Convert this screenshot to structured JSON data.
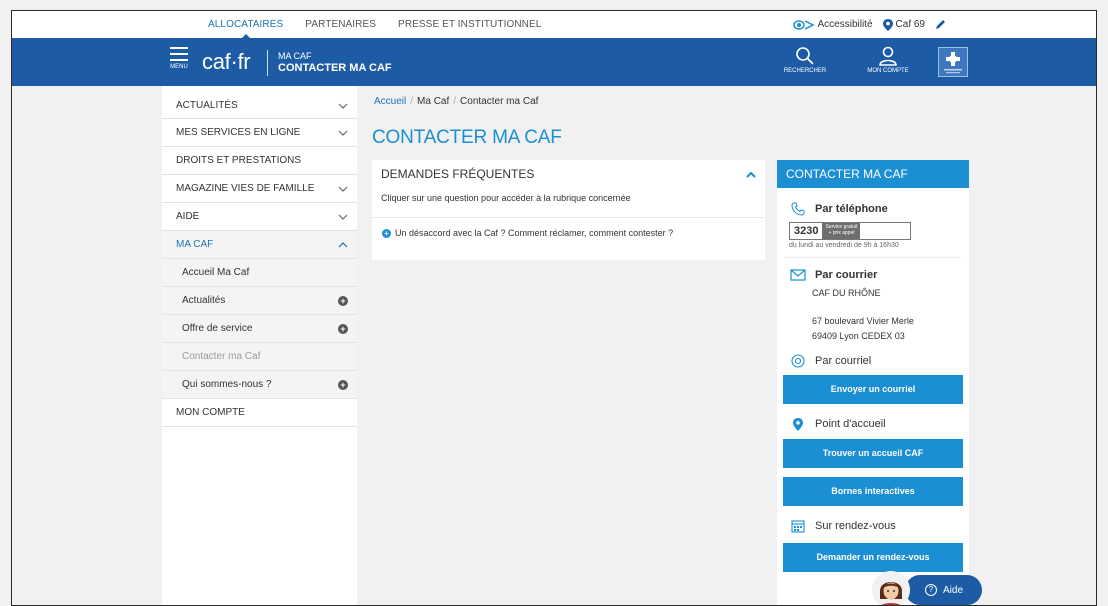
{
  "topbar": {
    "nav": [
      "ALLOCATAIRES",
      "PARTENAIRES",
      "PRESSE ET INSTITUTIONNEL"
    ],
    "accessibility": "Accessibilité",
    "location": "Caf 69"
  },
  "header": {
    "menu_label": "MENU",
    "logo": "caf·fr",
    "section_small": "MA CAF",
    "section_big": "CONTACTER MA CAF",
    "search_label": "RECHERCHER",
    "account_label": "MON COMPTE"
  },
  "sidebar": {
    "items": [
      {
        "label": "ACTUALITÉS"
      },
      {
        "label": "MES SERVICES EN LIGNE"
      },
      {
        "label": "DROITS ET PRESTATIONS"
      },
      {
        "label": "MAGAZINE VIES DE FAMILLE"
      },
      {
        "label": "AIDE"
      },
      {
        "label": "MA CAF"
      }
    ],
    "sub_items": [
      {
        "label": "Accueil Ma Caf"
      },
      {
        "label": "Actualités"
      },
      {
        "label": "Offre de service"
      },
      {
        "label": "Contacter ma Caf"
      },
      {
        "label": "Qui sommes-nous ?"
      }
    ],
    "last_item": "MON COMPTE"
  },
  "breadcrumb": {
    "home": "Accueil",
    "parent": "Ma Caf",
    "current": "Contacter ma Caf"
  },
  "page_title": "CONTACTER MA CAF",
  "faq": {
    "title": "DEMANDES FRÉQUENTES",
    "description": "Cliquer sur une question pour accéder à la rubrique concernée",
    "question": "Un désaccord avec la Caf ? Comment réclamer, comment contester ?"
  },
  "contact": {
    "title": "CONTACTER MA CAF",
    "phone_label": "Par téléphone",
    "phone_number": "3230",
    "phone_tag_1": "Service gratuit",
    "phone_tag_2": "+ prix appel",
    "hours": "du lundi au vendredi de 9h à 16h30",
    "mail_label": "Par courrier",
    "address_name": "CAF DU RHÔNE",
    "address_line1": "67 boulevard Vivier Merle",
    "address_line2": "69409 Lyon CEDEX 03",
    "email_label": "Par courriel",
    "email_button": "Envoyer un courriel",
    "point_label": "Point d'accueil",
    "find_button": "Trouver un accueil CAF",
    "kiosk_button": "Bornes interactives",
    "rdv_label": "Sur rendez-vous",
    "rdv_button": "Demander un rendez-vous"
  },
  "chat": {
    "label": "Aide"
  },
  "colors": {
    "brand_blue": "#1d5ca5",
    "accent_blue": "#1b8ed4"
  }
}
